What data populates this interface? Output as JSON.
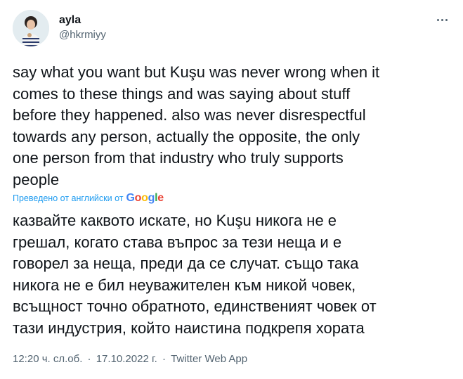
{
  "author": {
    "display_name": "ayla",
    "handle": "@hkrmiyy"
  },
  "tweet": {
    "text": "say what you want but Kuşu was never wrong when it\ncomes to these things and was saying about stuff\nbefore they happened. also was never disrespectful\ntowards any person, actually the opposite, the only\none person from that industry who truly supports\npeople",
    "translation_credit": "Преведено от английски от",
    "translation_provider": "Google",
    "translated_text": "казвайте каквото искате, но Kuşu никога не е\nгрешал, когато става въпрос за тези неща и е\nговорел за неща, преди да се случат. също така\nникога не е бил неуважителен към никой човек,\nвсъщност точно обратното, единственият човек от\nтази индустрия, който наистина подкрепя хората"
  },
  "meta": {
    "time": "12:20 ч. сл.об.",
    "separator": "·",
    "date": "17.10.2022 г.",
    "source": "Twitter Web App"
  },
  "icons": {
    "more": "more-horizontal-icon",
    "avatar": "profile-photo"
  },
  "colors": {
    "link": "#1d9bf0",
    "secondary_text": "#536471",
    "primary_text": "#0f1419"
  }
}
